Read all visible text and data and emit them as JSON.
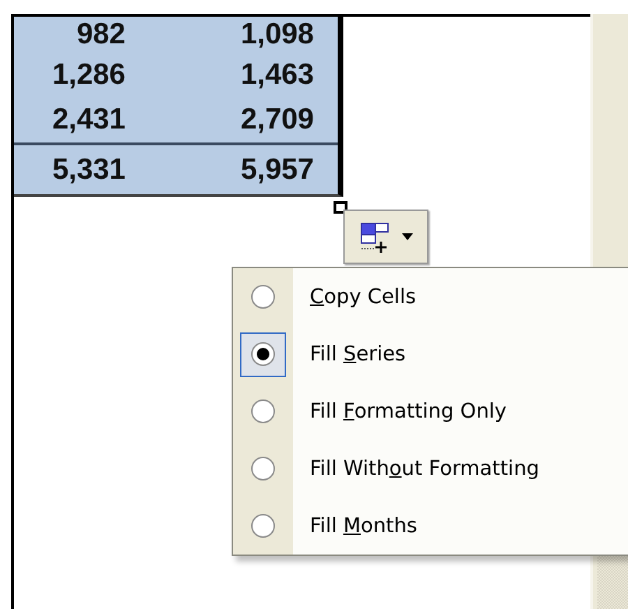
{
  "sheet": {
    "rows": [
      {
        "cells": [
          "982",
          "1,098"
        ]
      },
      {
        "cells": [
          "1,286",
          "1,463"
        ]
      },
      {
        "cells": [
          "2,431",
          "2,709"
        ]
      },
      {
        "cells": [
          "5,331",
          "5,957"
        ],
        "kind": "total"
      }
    ]
  },
  "fill_options_menu": {
    "items": [
      {
        "access_key": "C",
        "text_after": "opy Cells",
        "selected": false
      },
      {
        "text_before": "Fill ",
        "access_key": "S",
        "text_after": "eries",
        "selected": true
      },
      {
        "text_before": "Fill ",
        "access_key": "F",
        "text_after": "ormatting Only",
        "selected": false
      },
      {
        "text_before": "Fill With",
        "access_key": "o",
        "text_after": "ut Formatting",
        "selected": false
      },
      {
        "text_before": "Fill ",
        "access_key": "M",
        "text_after": "onths",
        "selected": false
      }
    ]
  }
}
